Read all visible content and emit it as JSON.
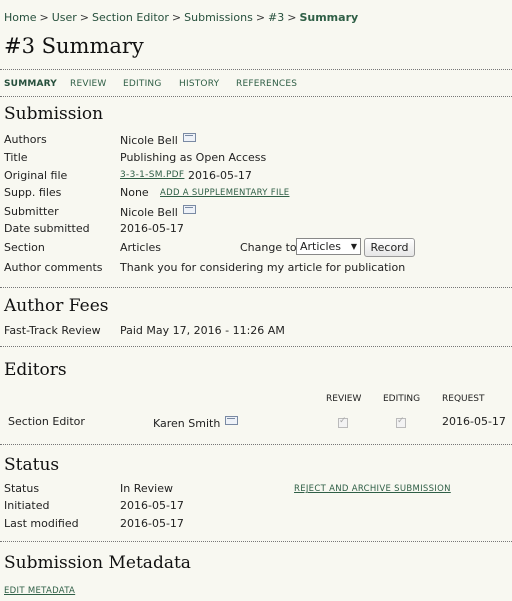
{
  "breadcrumb": {
    "items": [
      "Home",
      "User",
      "Section Editor",
      "Submissions",
      "#3"
    ],
    "current": "Summary",
    "separator": ">"
  },
  "page_title": "#3 Summary",
  "tabs": [
    "Summary",
    "Review",
    "Editing",
    "History",
    "References"
  ],
  "submission": {
    "heading": "Submission",
    "authors_label": "Authors",
    "authors_value": "Nicole Bell",
    "title_label": "Title",
    "title_value": "Publishing as Open Access",
    "original_file_label": "Original file",
    "original_file_link": "3-3-1-SM.PDF",
    "original_file_date": "2016-05-17",
    "supp_files_label": "Supp. files",
    "supp_files_value": "None",
    "add_supp_link": "ADD A SUPPLEMENTARY FILE",
    "submitter_label": "Submitter",
    "submitter_value": "Nicole Bell",
    "date_submitted_label": "Date submitted",
    "date_submitted_value": "2016-05-17",
    "section_label": "Section",
    "section_value": "Articles",
    "change_to_label": "Change to",
    "section_select_value": "Articles",
    "record_button": "Record",
    "author_comments_label": "Author comments",
    "author_comments_value": "Thank you for considering my article for publication"
  },
  "author_fees": {
    "heading": "Author Fees",
    "fast_track_label": "Fast-Track Review",
    "fast_track_value": "Paid May 17, 2016 - 11:26 AM"
  },
  "editors": {
    "heading": "Editors",
    "col_review": "REVIEW",
    "col_editing": "EDITING",
    "col_request": "REQUEST",
    "row": {
      "role": "Section Editor",
      "name": "Karen Smith",
      "review_checked": true,
      "editing_checked": true,
      "request": "2016-05-17"
    }
  },
  "status": {
    "heading": "Status",
    "status_label": "Status",
    "status_value": "In Review",
    "reject_link": "REJECT AND ARCHIVE SUBMISSION",
    "initiated_label": "Initiated",
    "initiated_value": "2016-05-17",
    "last_modified_label": "Last modified",
    "last_modified_value": "2016-05-17"
  },
  "metadata": {
    "heading": "Submission Metadata",
    "edit_link": "EDIT METADATA"
  },
  "icons": {
    "email": "envelope-icon",
    "select_arrow": "triangle-down-icon",
    "checkbox": "checkmark-icon"
  },
  "colors": {
    "background": "#f8f8f1",
    "link": "#2f5f46"
  }
}
